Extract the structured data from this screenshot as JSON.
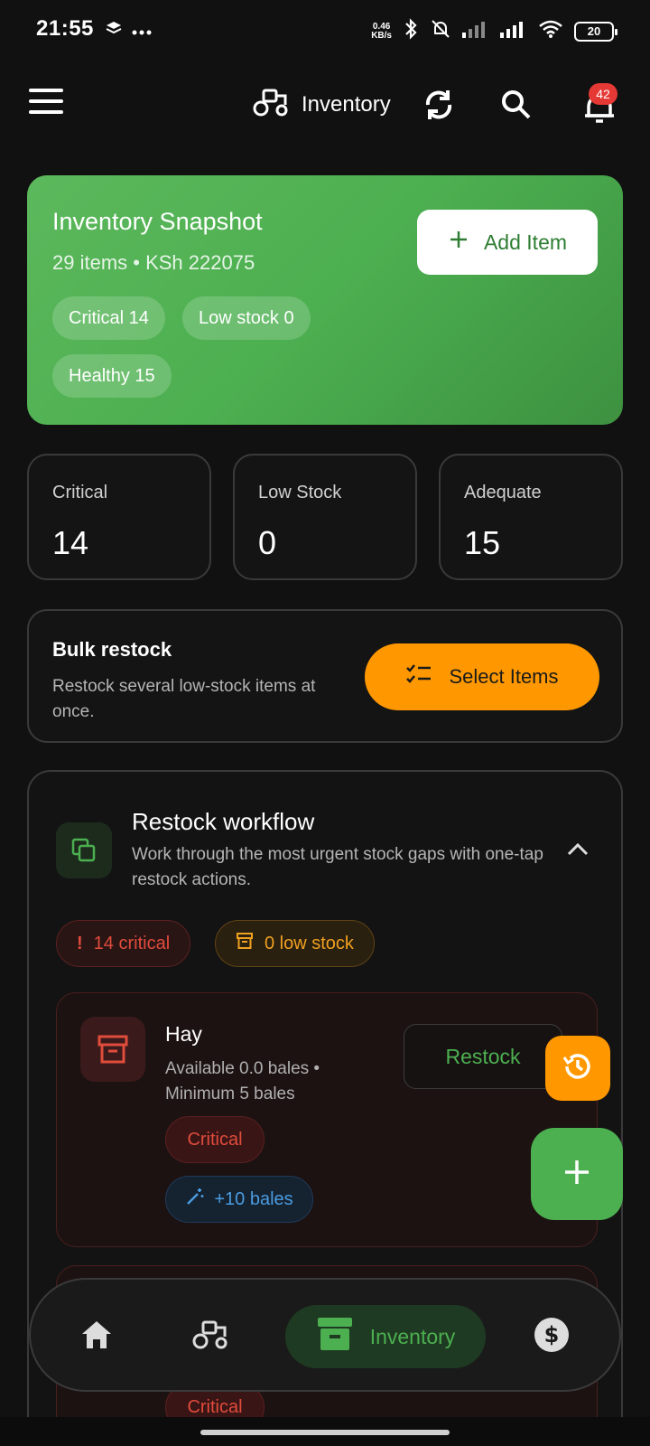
{
  "status_bar": {
    "time": "21:55",
    "net_speed_value": "0.46",
    "net_speed_unit": "KB/s",
    "battery": "20",
    "icons": [
      "layers-icon",
      "more-dots-icon",
      "bluetooth-icon",
      "bell-muted-icon",
      "signal-icon",
      "signal-icon",
      "wifi-icon",
      "battery-icon"
    ]
  },
  "app_bar": {
    "title": "Inventory",
    "notification_count": "42",
    "icons": [
      "menu-icon",
      "tractor-icon",
      "sync-icon",
      "search-icon",
      "bell-icon"
    ]
  },
  "snapshot": {
    "title": "Inventory Snapshot",
    "subtitle": "29 items • KSh 222075",
    "add_button": "Add Item",
    "chips": [
      "Critical 14",
      "Low stock 0",
      "Healthy 15"
    ]
  },
  "stats": [
    {
      "label": "Critical",
      "value": "14"
    },
    {
      "label": "Low Stock",
      "value": "0"
    },
    {
      "label": "Adequate",
      "value": "15"
    }
  ],
  "bulk": {
    "title": "Bulk restock",
    "description": "Restock several low-stock items at once.",
    "button": "Select Items"
  },
  "workflow": {
    "title": "Restock workflow",
    "description": "Work through the most urgent stock gaps with one-tap restock actions.",
    "critical_pill": "14 critical",
    "low_pill": "0 low stock",
    "items": [
      {
        "name": "Hay",
        "detail": "Available 0.0 bales • Minimum 5 bales",
        "action": "Restock",
        "status": "Critical",
        "suggestion": "+10 bales"
      },
      {
        "status": "Critical"
      }
    ]
  },
  "bottom_nav": {
    "active_label": "Inventory",
    "items": [
      "home-icon",
      "tractor-icon",
      "inventory-icon",
      "finance-icon"
    ]
  },
  "colors": {
    "accent_green": "#4caf50",
    "accent_orange": "#ff9800",
    "critical_red": "#e04c3c",
    "badge_red": "#e53935"
  }
}
